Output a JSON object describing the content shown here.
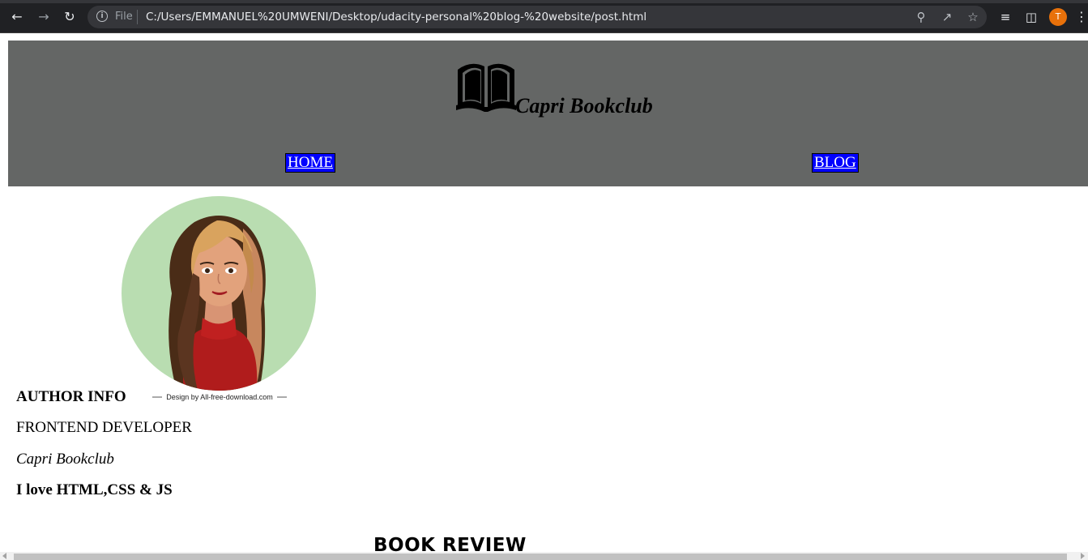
{
  "browser": {
    "scheme_label": "File",
    "url": "C:/Users/EMMANUEL%20UMWENI/Desktop/udacity-personal%20blog-%20website/post.html",
    "profile_initial": "T",
    "icons": {
      "back": "back-arrow-icon",
      "forward": "forward-arrow-icon",
      "reload": "reload-icon",
      "info": "info-icon",
      "zoom": "zoom-icon",
      "share": "share-icon",
      "bookmark": "star-icon",
      "reading_list": "reading-list-icon",
      "side_panel": "side-panel-icon",
      "menu": "kebab-menu-icon"
    }
  },
  "header": {
    "brand": "Capri Bookclub",
    "logo_icon": "open-book-icon",
    "background": "#646665",
    "nav": {
      "home": "HOME",
      "blog": "BLOG"
    },
    "nav_colors": {
      "bg": "#0000ff",
      "text": "#ffffff"
    }
  },
  "author": {
    "image_credit": "Design by All-free-download.com",
    "title": "AUTHOR INFO",
    "role": "FRONTEND DEVELOPER",
    "club": "Capri Bookclub",
    "tagline": "I love HTML,CSS & JS"
  },
  "main": {
    "section_heading": "BOOK REVIEW"
  }
}
